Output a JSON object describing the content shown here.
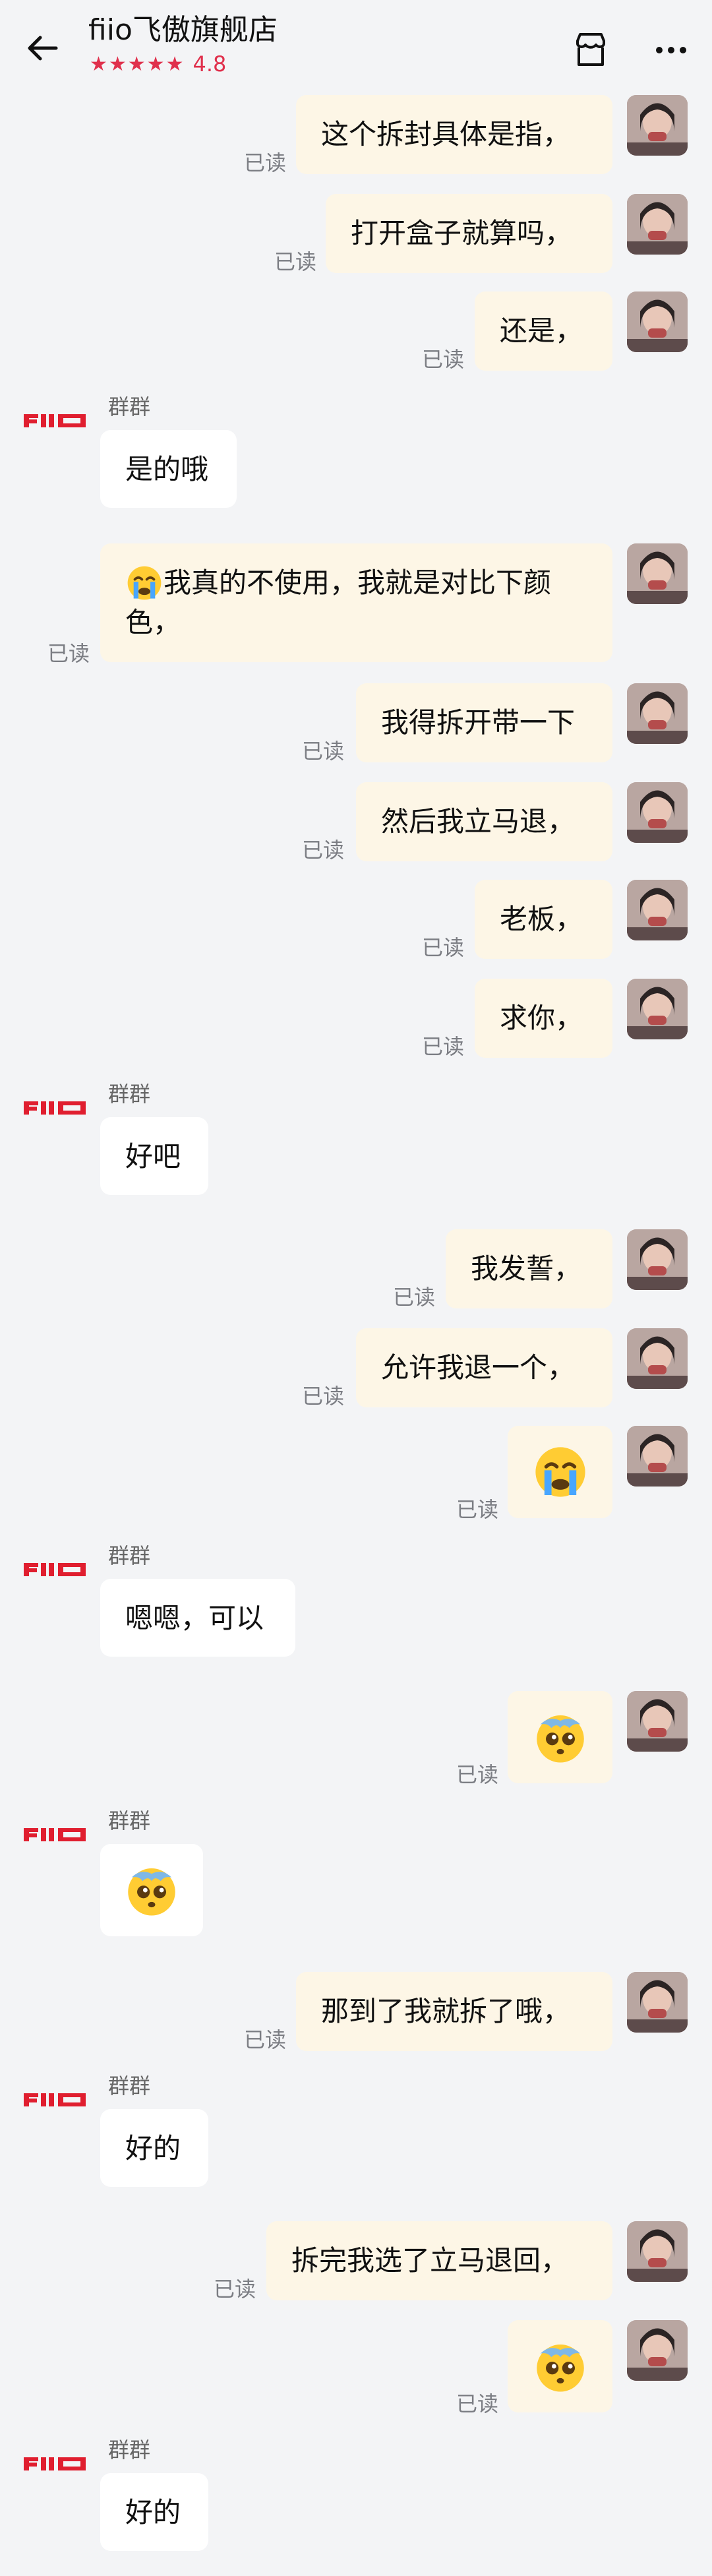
{
  "header": {
    "title": "fiio飞傲旗舰店",
    "stars": "★★★★★",
    "rating": "4.8",
    "accent": "#e0304c"
  },
  "read_label": "已读",
  "store_sender": "群群",
  "messages": {
    "m1": "这个拆封具体是指，",
    "m2": "打开盒子就算吗，",
    "m3": "还是，",
    "r1": "是的哦",
    "m4_line1": "我真的不使用，我就是对比下颜",
    "m4_line2": "色，",
    "m5": "我得拆开带一下",
    "m6": "然后我立马退，",
    "m7": "老板，",
    "m8": "求你，",
    "r2": "好吧",
    "m9": "我发誓，",
    "m10": "允许我退一个，",
    "r3": "嗯嗯，可以",
    "m13": "那到了我就拆了哦，",
    "r5": "好的",
    "m14": "拆完我选了立马退回，",
    "r6": "好的"
  },
  "icons": {
    "back": "back-arrow-icon",
    "store": "store-icon",
    "more": "more-icon",
    "crying": "crying-face-emoji",
    "pleading": "pleading-face-emoji"
  }
}
